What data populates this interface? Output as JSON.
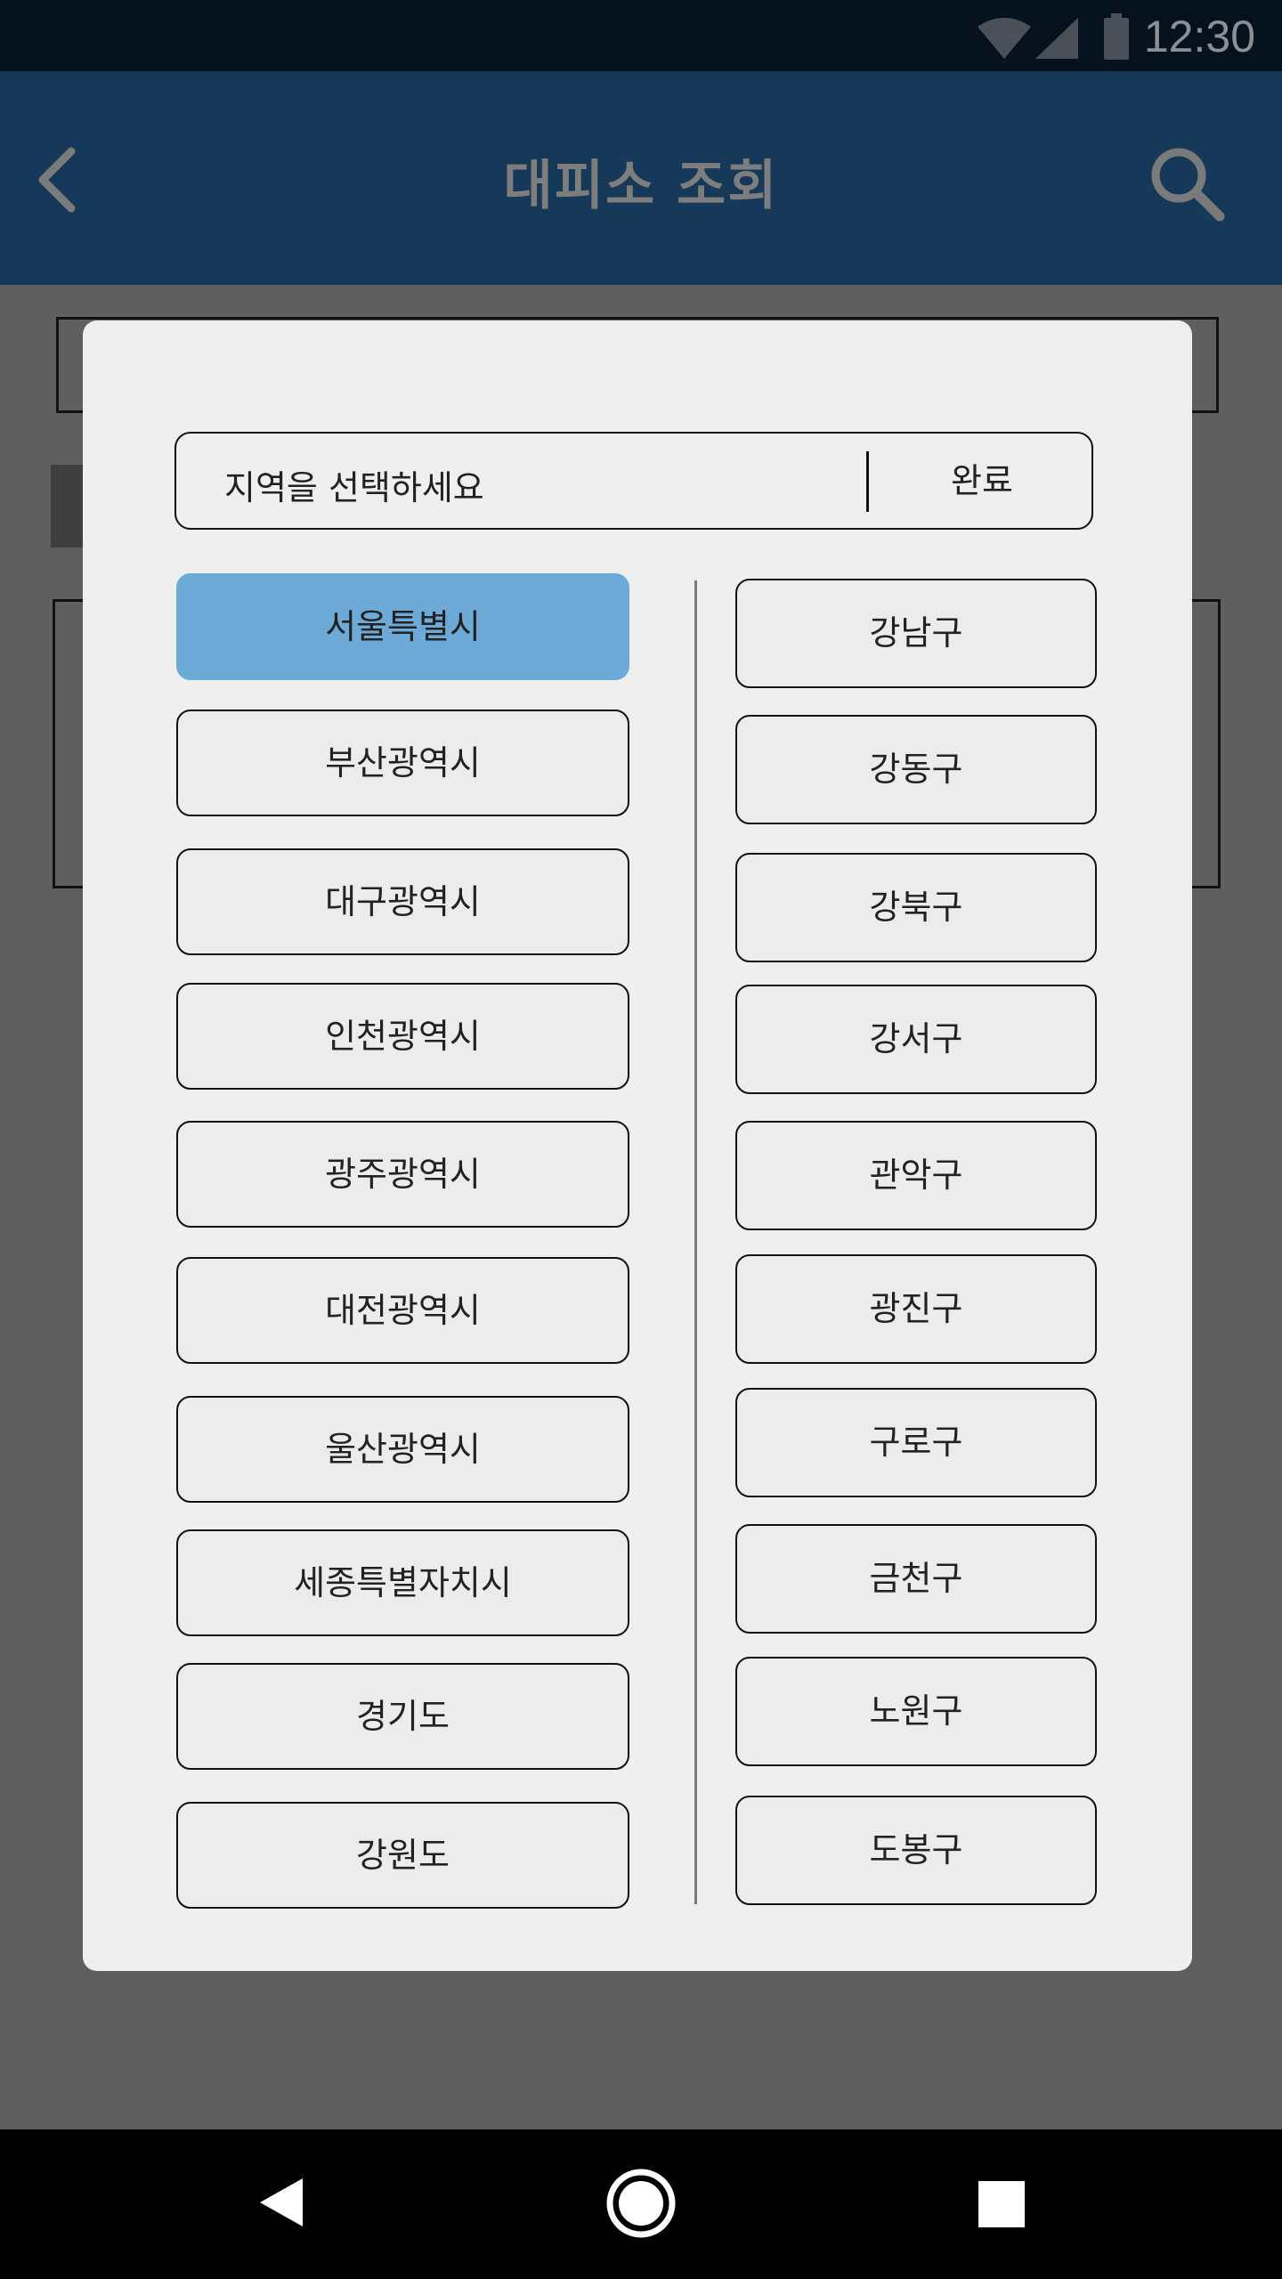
{
  "status_bar": {
    "time": "12:30"
  },
  "app_bar": {
    "title": "대피소 조회"
  },
  "dialog": {
    "placeholder": "지역을 선택하세요",
    "done_label": "완료",
    "cities": [
      "서울특별시",
      "부산광역시",
      "대구광역시",
      "인천광역시",
      "광주광역시",
      "대전광역시",
      "울산광역시",
      "세종특별자치시",
      "경기도",
      "강원도"
    ],
    "selected_city": "서울특별시",
    "districts": [
      "강남구",
      "강동구",
      "강북구",
      "강서구",
      "관악구",
      "광진구",
      "구로구",
      "금천구",
      "노원구",
      "도봉구"
    ]
  },
  "colors": {
    "selected": "#6eaad8",
    "app_bar": "#16395a",
    "status_bar": "#05121e"
  }
}
